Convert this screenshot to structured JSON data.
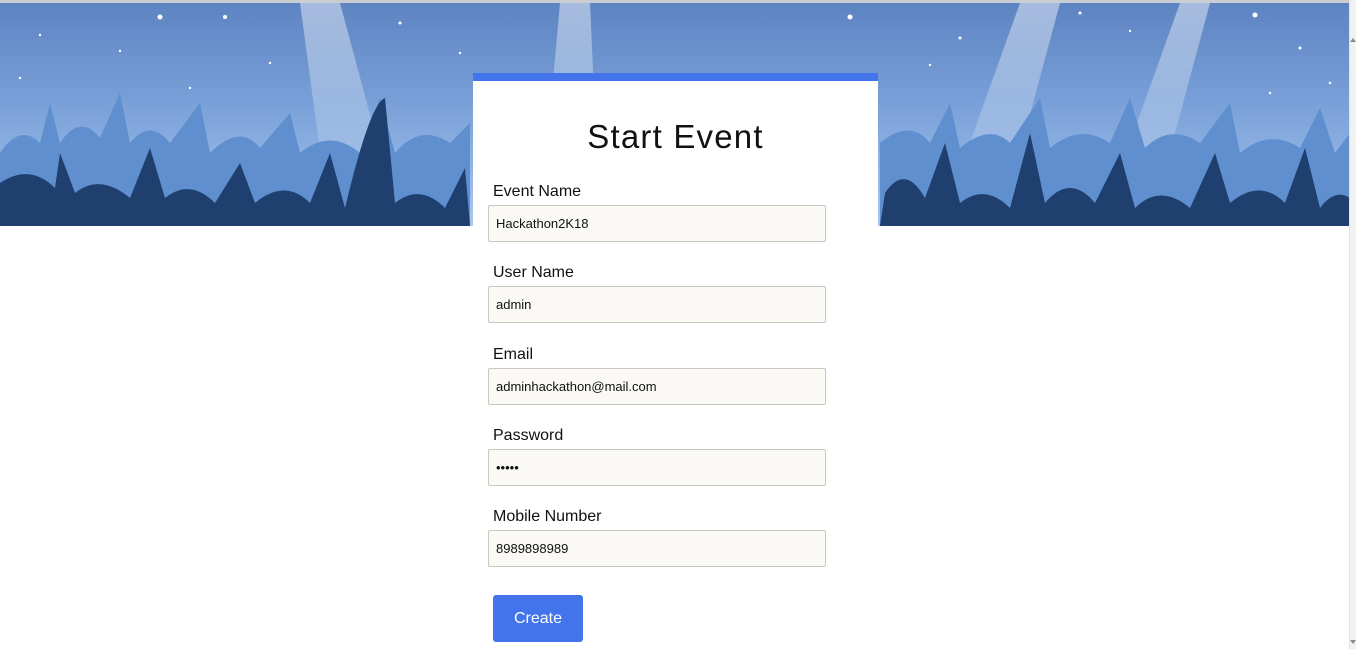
{
  "form": {
    "title": "Start Event",
    "fields": [
      {
        "label": "Event Name",
        "value": "Hackathon2K18",
        "type": "text"
      },
      {
        "label": "User Name",
        "value": "admin",
        "type": "text"
      },
      {
        "label": "Email",
        "value": "adminhackathon@mail.com",
        "type": "email"
      },
      {
        "label": "Password",
        "value": "•••••",
        "type": "password"
      },
      {
        "label": "Mobile Number",
        "value": "8989898989",
        "type": "tel"
      }
    ],
    "submit_label": "Create"
  },
  "colors": {
    "accent": "#4374ec",
    "banner_sky": "#79a0d8",
    "crowd_dark": "#1f3f6f",
    "crowd_light": "#5f8fcf"
  }
}
